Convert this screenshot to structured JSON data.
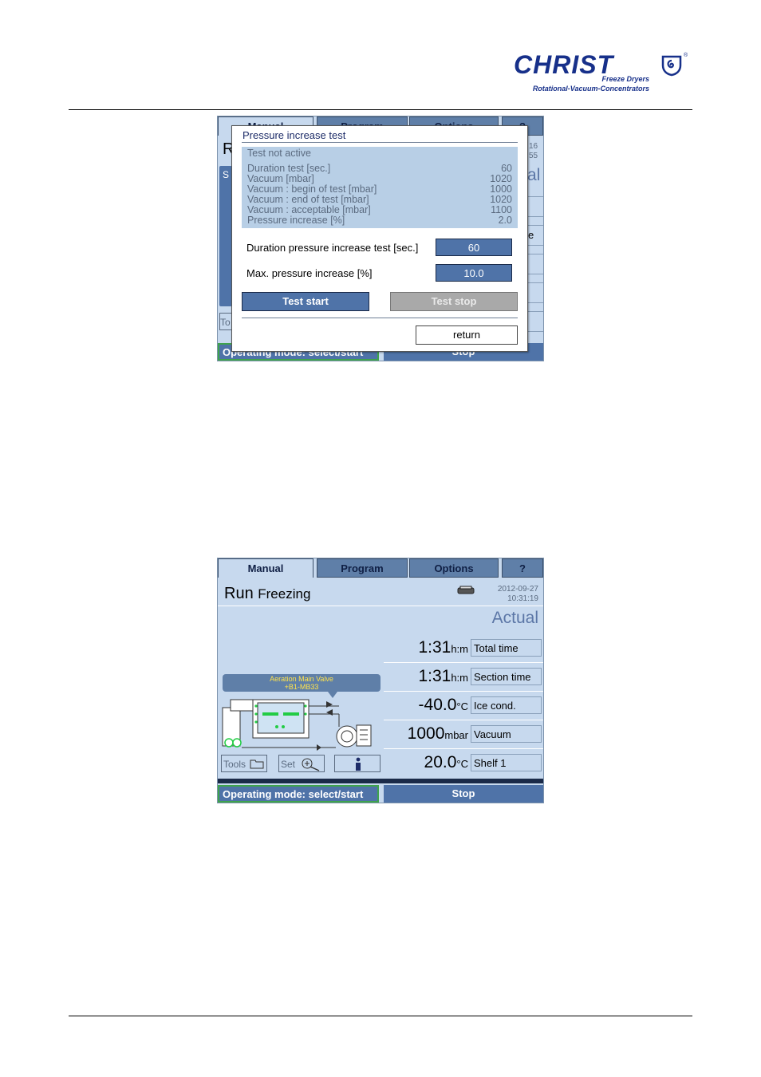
{
  "header": {
    "brand": "CHRIST",
    "tagline1": "Freeze Dryers",
    "tagline2": "Rotational-Vacuum-Concentrators",
    "registered": "®",
    "brand_color": "#17308a"
  },
  "screen1": {
    "tabs": [
      "Manual",
      "Program",
      "Options",
      "?"
    ],
    "peek": {
      "left_letter": "R",
      "left_box": "S",
      "left_tool": "To",
      "right_date": "16",
      "right_time": "55",
      "right_big": "al",
      "right_label": "e"
    },
    "dialog": {
      "title": "Pressure increase test",
      "status": "Test not active",
      "rows": [
        {
          "label": "Duration test [sec.]",
          "value": "60"
        },
        {
          "label": "Vacuum [mbar]",
          "value": "1020"
        },
        {
          "label": "Vacuum : begin of test [mbar]",
          "value": "1000"
        },
        {
          "label": "Vacuum : end of test [mbar]",
          "value": "1020"
        },
        {
          "label": "Vacuum : acceptable [mbar]",
          "value": "1100"
        },
        {
          "label": "Pressure increase [%]",
          "value": "2.0"
        }
      ],
      "duration_label": "Duration pressure increase test [sec.]",
      "duration_value": "60",
      "max_label": "Max. pressure increase [%]",
      "max_value": "10.0",
      "test_start": "Test start",
      "test_stop": "Test stop",
      "return": "return"
    },
    "status": {
      "mode": "Operating mode: select/start",
      "stop": "Stop"
    }
  },
  "screen2": {
    "tabs": [
      "Manual",
      "Program",
      "Options",
      "?"
    ],
    "run": "Run",
    "phase": "Freezing",
    "date": "2012-09-27",
    "time": "10:31:19",
    "actual": "Actual",
    "readings": [
      {
        "value": "1:31",
        "unit": "h:m",
        "label": "Total time"
      },
      {
        "value": "1:31",
        "unit": "h:m",
        "label": "Section time"
      },
      {
        "value": "-40.0",
        "unit": "°C",
        "label": "Ice cond."
      },
      {
        "value": "1000",
        "unit": "mbar",
        "label": "Vacuum"
      },
      {
        "value": "20.0",
        "unit": "°C",
        "label": "Shelf 1"
      }
    ],
    "tooltip_line1": "Aeration Main Valve",
    "tooltip_line2": "+B1-MB33",
    "tools": "Tools",
    "set": "Set",
    "status": {
      "mode": "Operating mode: select/start",
      "stop": "Stop"
    },
    "colors": {
      "accent": "#4f73a8",
      "screen_bg": "#c7d9ee",
      "valve_green": "#22cc44"
    }
  }
}
